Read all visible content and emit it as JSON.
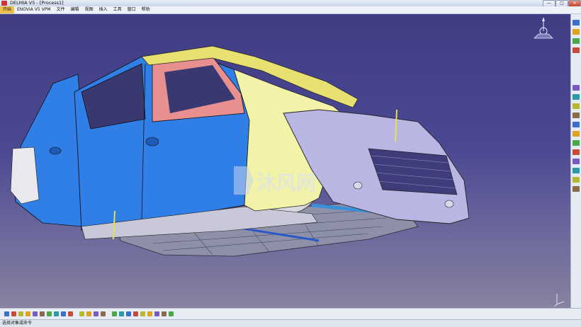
{
  "window": {
    "title": "DELMIA V5 - [Process1]",
    "controls": {
      "minimize": "—",
      "maximize": "□",
      "close": "✕"
    }
  },
  "menu": [
    {
      "label": "开始",
      "active": true
    },
    {
      "label": "ENOVIA V5 VPM"
    },
    {
      "label": "文件"
    },
    {
      "label": "编辑"
    },
    {
      "label": "视图"
    },
    {
      "label": "插入"
    },
    {
      "label": "工具"
    },
    {
      "label": "窗口"
    },
    {
      "label": "帮助"
    }
  ],
  "viewport": {
    "model": "car-body-in-white",
    "watermark": "沐风网",
    "colors": {
      "door": "#2f7fe6",
      "fender": "#f2f2a8",
      "front-fascia": "#b9b6e4",
      "floor": "#8d8fa8",
      "inner-panel": "#e88f8f",
      "roof-rail": "#e8e070"
    }
  },
  "status": {
    "text": "选择对象或命令"
  },
  "icons": {
    "right_toolbar": [
      "sketch-icon",
      "point-icon",
      "line-icon",
      "plane-icon",
      "sweep-icon",
      "fill-icon",
      "split-icon",
      "trim-icon",
      "join-icon",
      "measure-icon",
      "hammer-icon",
      "filter-icon",
      "product-icon",
      "catalog-icon",
      "tree-icon",
      "check-icon"
    ],
    "bottom_toolbar": [
      "new-icon",
      "open-icon",
      "save-icon",
      "print-icon",
      "cut-icon",
      "copy-icon",
      "paste-icon",
      "undo-icon",
      "redo-icon",
      "whatsthis-icon",
      "formula-icon",
      "knowledge-icon",
      "fly-icon",
      "fit-all-icon",
      "pan-icon",
      "rotate-icon",
      "zoom-in-icon",
      "zoom-out-icon",
      "normal-view-icon",
      "views-icon",
      "render-style-icon",
      "hide-show-icon",
      "swap-space-icon"
    ]
  }
}
